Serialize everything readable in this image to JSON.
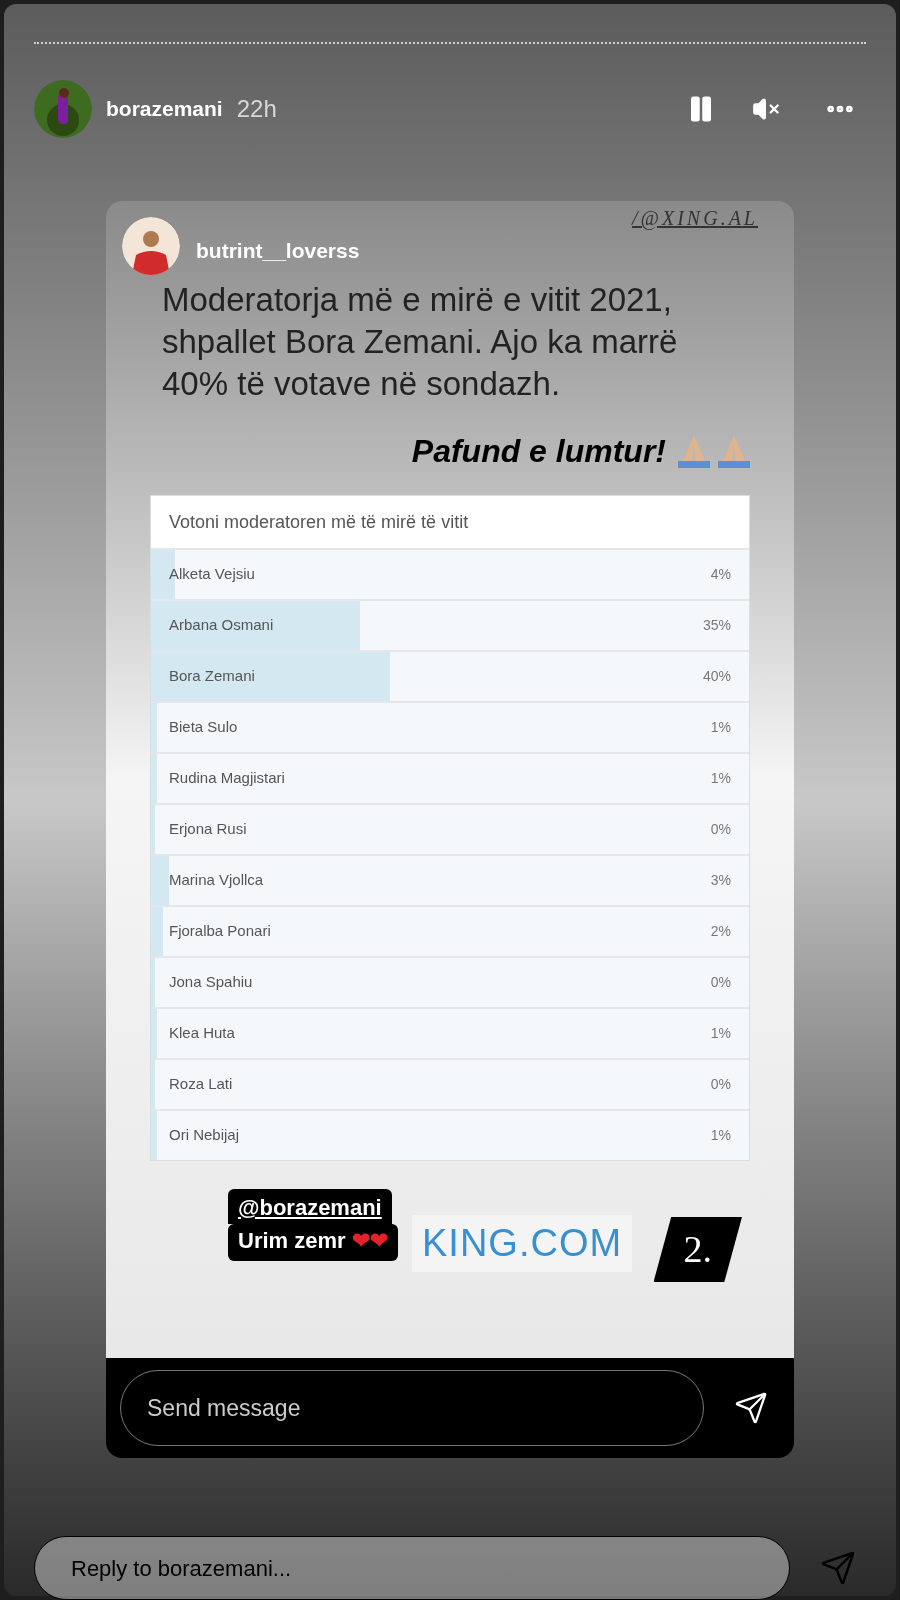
{
  "story_header": {
    "username": "borazemani",
    "time": "22h"
  },
  "post": {
    "username": "butrint__loverss",
    "watermark": "/@XING.AL",
    "headline": "Moderatorja më e mirë e vitit 2021, shpallet Bora Zemani. Ajo ka marrë 40% të votave në sondazh.",
    "caption": "Pafund e lumtur!",
    "poll": {
      "title": "Votoni moderatoren më të mirë të vitit",
      "options": [
        {
          "name": "Alketa Vejsiu",
          "percent": "4%",
          "level": 0.04
        },
        {
          "name": "Arbana Osmani",
          "percent": "35%",
          "level": 0.35
        },
        {
          "name": "Bora Zemani",
          "percent": "40%",
          "level": 0.4
        },
        {
          "name": "Bieta Sulo",
          "percent": "1%",
          "level": 0.01
        },
        {
          "name": "Rudina Magjistari",
          "percent": "1%",
          "level": 0.01
        },
        {
          "name": "Erjona Rusi",
          "percent": "0%",
          "level": 0
        },
        {
          "name": "Marina Vjollca",
          "percent": "3%",
          "level": 0.03
        },
        {
          "name": "Fjoralba Ponari",
          "percent": "2%",
          "level": 0.02
        },
        {
          "name": "Jona Spahiu",
          "percent": "0%",
          "level": 0
        },
        {
          "name": "Klea Huta",
          "percent": "1%",
          "level": 0.01
        },
        {
          "name": "Roza Lati",
          "percent": "0%",
          "level": 0
        },
        {
          "name": "Ori Nebijaj",
          "percent": "1%",
          "level": 0.01
        }
      ]
    },
    "mention": "@borazemani",
    "mention_text": "Urim zemr",
    "hearts": "❤❤",
    "site": "KING.COM",
    "number": "2.",
    "message_placeholder": "Send message"
  },
  "reply": {
    "placeholder": "Reply to borazemani..."
  }
}
